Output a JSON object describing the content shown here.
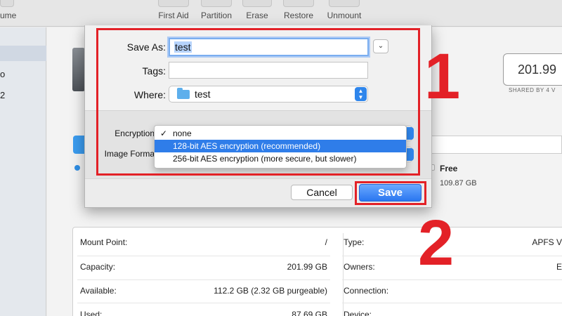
{
  "toolbar": {
    "left_partial": "ume",
    "items": [
      {
        "label": "First Aid"
      },
      {
        "label": "Partition"
      },
      {
        "label": "Erase"
      },
      {
        "label": "Restore"
      },
      {
        "label": "Unmount"
      }
    ]
  },
  "sidebar": {
    "items": [
      {
        "label": ""
      },
      {
        "label": "o"
      },
      {
        "label": "2"
      }
    ]
  },
  "disk": {
    "capacity_display": "201.99",
    "shared_by": "SHARED BY 4 V",
    "free_label": "Free",
    "free_value": "109.87 GB"
  },
  "info": {
    "left": [
      {
        "label": "Mount Point:",
        "value": "/"
      },
      {
        "label": "Capacity:",
        "value": "201.99 GB"
      },
      {
        "label": "Available:",
        "value": "112.2 GB (2.32 GB purgeable)"
      },
      {
        "label": "Used:",
        "value": "87.69 GB"
      }
    ],
    "right": [
      {
        "label": "Type:",
        "value": "APFS V"
      },
      {
        "label": "Owners:",
        "value": "E"
      },
      {
        "label": "Connection:",
        "value": ""
      },
      {
        "label": "Device:",
        "value": ""
      }
    ]
  },
  "dialog": {
    "save_as_label": "Save As:",
    "save_as_value": "test",
    "tags_label": "Tags:",
    "tags_value": "",
    "where_label": "Where:",
    "where_value": "test",
    "encryption_label": "Encryption",
    "image_format_label": "Image Forma",
    "encryption_options": [
      {
        "label": "none",
        "checked": true
      },
      {
        "label": "128-bit AES encryption (recommended)",
        "highlighted": true
      },
      {
        "label": "256-bit AES encryption (more secure, but slower)"
      }
    ],
    "cancel_label": "Cancel",
    "save_label": "Save"
  },
  "annotations": {
    "step1": "1",
    "step2": "2",
    "color": "#e32127"
  },
  "colors": {
    "accent": "#2f7de9",
    "save_button": "#2a76f0"
  }
}
